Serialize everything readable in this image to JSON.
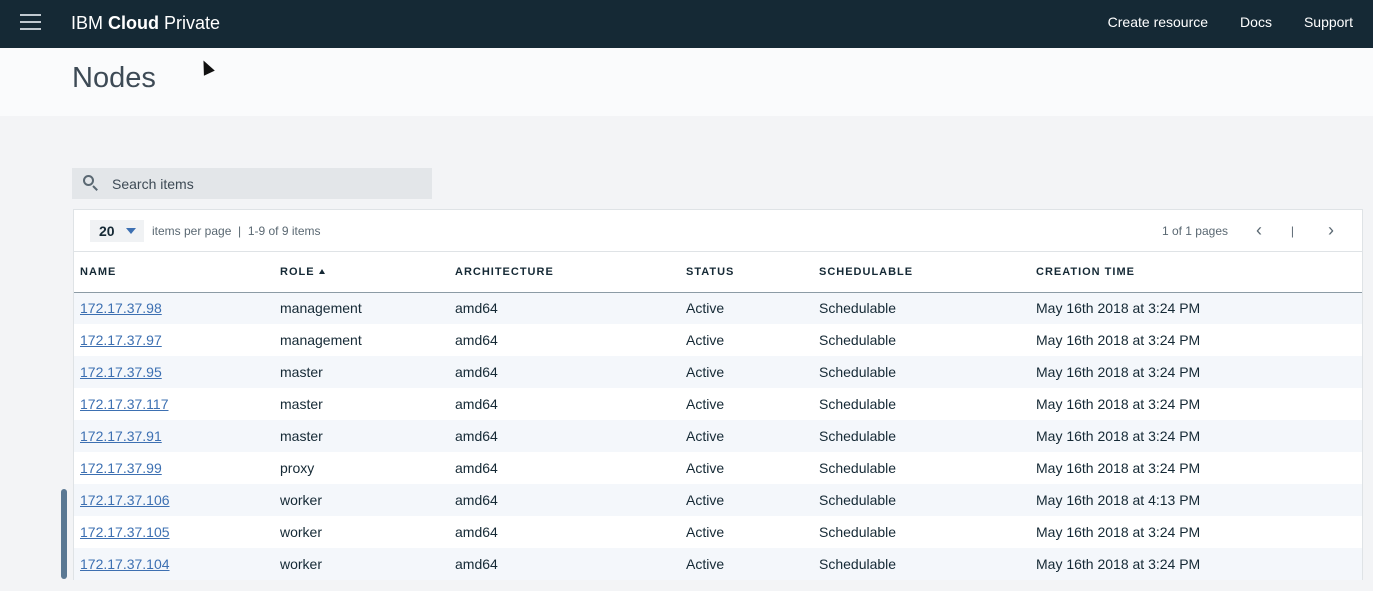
{
  "app": {
    "brand_regular": "IBM ",
    "brand_bold": "Cloud",
    "brand_suffix": " Private"
  },
  "nav": {
    "create_resource": "Create resource",
    "docs": "Docs",
    "support": "Support"
  },
  "page": {
    "title": "Nodes"
  },
  "search": {
    "placeholder": "Search items"
  },
  "pager": {
    "per_page_value": "20",
    "items_info": "items per page  |  1-9 of 9 items",
    "page_info": "1 of 1 pages",
    "prev": "‹",
    "separator": "|",
    "next": "›"
  },
  "table": {
    "columns": [
      "NAME",
      "ROLE",
      "ARCHITECTURE",
      "STATUS",
      "SCHEDULABLE",
      "CREATION TIME"
    ],
    "rows": [
      {
        "name": "172.17.37.98",
        "role": "management",
        "arch": "amd64",
        "status": "Active",
        "sched": "Schedulable",
        "created": "May 16th 2018 at 3:24 PM"
      },
      {
        "name": "172.17.37.97",
        "role": "management",
        "arch": "amd64",
        "status": "Active",
        "sched": "Schedulable",
        "created": "May 16th 2018 at 3:24 PM"
      },
      {
        "name": "172.17.37.95",
        "role": "master",
        "arch": "amd64",
        "status": "Active",
        "sched": "Schedulable",
        "created": "May 16th 2018 at 3:24 PM"
      },
      {
        "name": "172.17.37.117",
        "role": "master",
        "arch": "amd64",
        "status": "Active",
        "sched": "Schedulable",
        "created": "May 16th 2018 at 3:24 PM"
      },
      {
        "name": "172.17.37.91",
        "role": "master",
        "arch": "amd64",
        "status": "Active",
        "sched": "Schedulable",
        "created": "May 16th 2018 at 3:24 PM"
      },
      {
        "name": "172.17.37.99",
        "role": "proxy",
        "arch": "amd64",
        "status": "Active",
        "sched": "Schedulable",
        "created": "May 16th 2018 at 3:24 PM"
      },
      {
        "name": "172.17.37.106",
        "role": "worker",
        "arch": "amd64",
        "status": "Active",
        "sched": "Schedulable",
        "created": "May 16th 2018 at 4:13 PM"
      },
      {
        "name": "172.17.37.105",
        "role": "worker",
        "arch": "amd64",
        "status": "Active",
        "sched": "Schedulable",
        "created": "May 16th 2018 at 3:24 PM"
      },
      {
        "name": "172.17.37.104",
        "role": "worker",
        "arch": "amd64",
        "status": "Active",
        "sched": "Schedulable",
        "created": "May 16th 2018 at 3:24 PM"
      }
    ]
  }
}
